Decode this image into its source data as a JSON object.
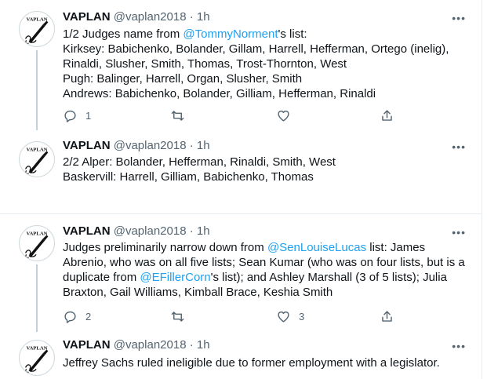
{
  "tweets": [
    {
      "name": "VAPLAN",
      "handle": "@vaplan2018",
      "dot": "·",
      "time": "1h",
      "line1_pre": "1/2 Judges name from ",
      "line1_mention": "@TommyNorment",
      "line1_post": "'s list:",
      "lines": [
        "Kirksey: Babichenko, Bolander, Gillam, Harrell, Hefferman, Ortego (inelig),",
        "Rinaldi, Slusher, Smith, Thomas, Trost-Thornton, West",
        "Pugh: Balinger, Harrell, Organ, Slusher, Smith",
        "Andrews: Babichenko, Bolander, Gilliam, Hefferman, Rinaldi"
      ],
      "reply_count": "1",
      "retweet_count": "",
      "like_count": ""
    },
    {
      "name": "VAPLAN",
      "handle": "@vaplan2018",
      "dot": "·",
      "time": "1h",
      "lines": [
        "2/2 Alper: Bolander, Hefferman, Rinaldi, Smith, West",
        "Baskervill: Harrell, Gilliam, Babichenko, Thomas"
      ]
    },
    {
      "name": "VAPLAN",
      "handle": "@vaplan2018",
      "dot": "·",
      "time": "1h",
      "line1_pre": "Judges preliminarily narrow down from ",
      "line1_mention": "@SenLouiseLucas",
      "line1_post": " list: James",
      "line2": "Abrenio, who was on all five lists; Sean Kumar (who was on four lists, but is a",
      "line3_pre": "duplicate from ",
      "line3_mention": "@EFillerCorn",
      "line3_post": "'s list); and Ashley Marshall (3 of 5 lists); Julia",
      "line4": "Braxton, Gail Williams, Kimball Brace, Keshia Smith",
      "reply_count": "2",
      "retweet_count": "",
      "like_count": "3"
    },
    {
      "name": "VAPLAN",
      "handle": "@vaplan2018",
      "dot": "·",
      "time": "1h",
      "lines": [
        "Jeffrey Sachs ruled ineligible due to former employment with a legislator."
      ]
    }
  ],
  "more_label": "•••",
  "avatar_text": "VAPLAN",
  "colors": {
    "link": "#1da1f2",
    "secondary": "#536471",
    "divider": "#e6ecf0",
    "thread_line": "#c4cfd6"
  },
  "icons": [
    "reply-icon",
    "retweet-icon",
    "like-icon",
    "share-icon",
    "more-icon",
    "avatar-logo"
  ]
}
